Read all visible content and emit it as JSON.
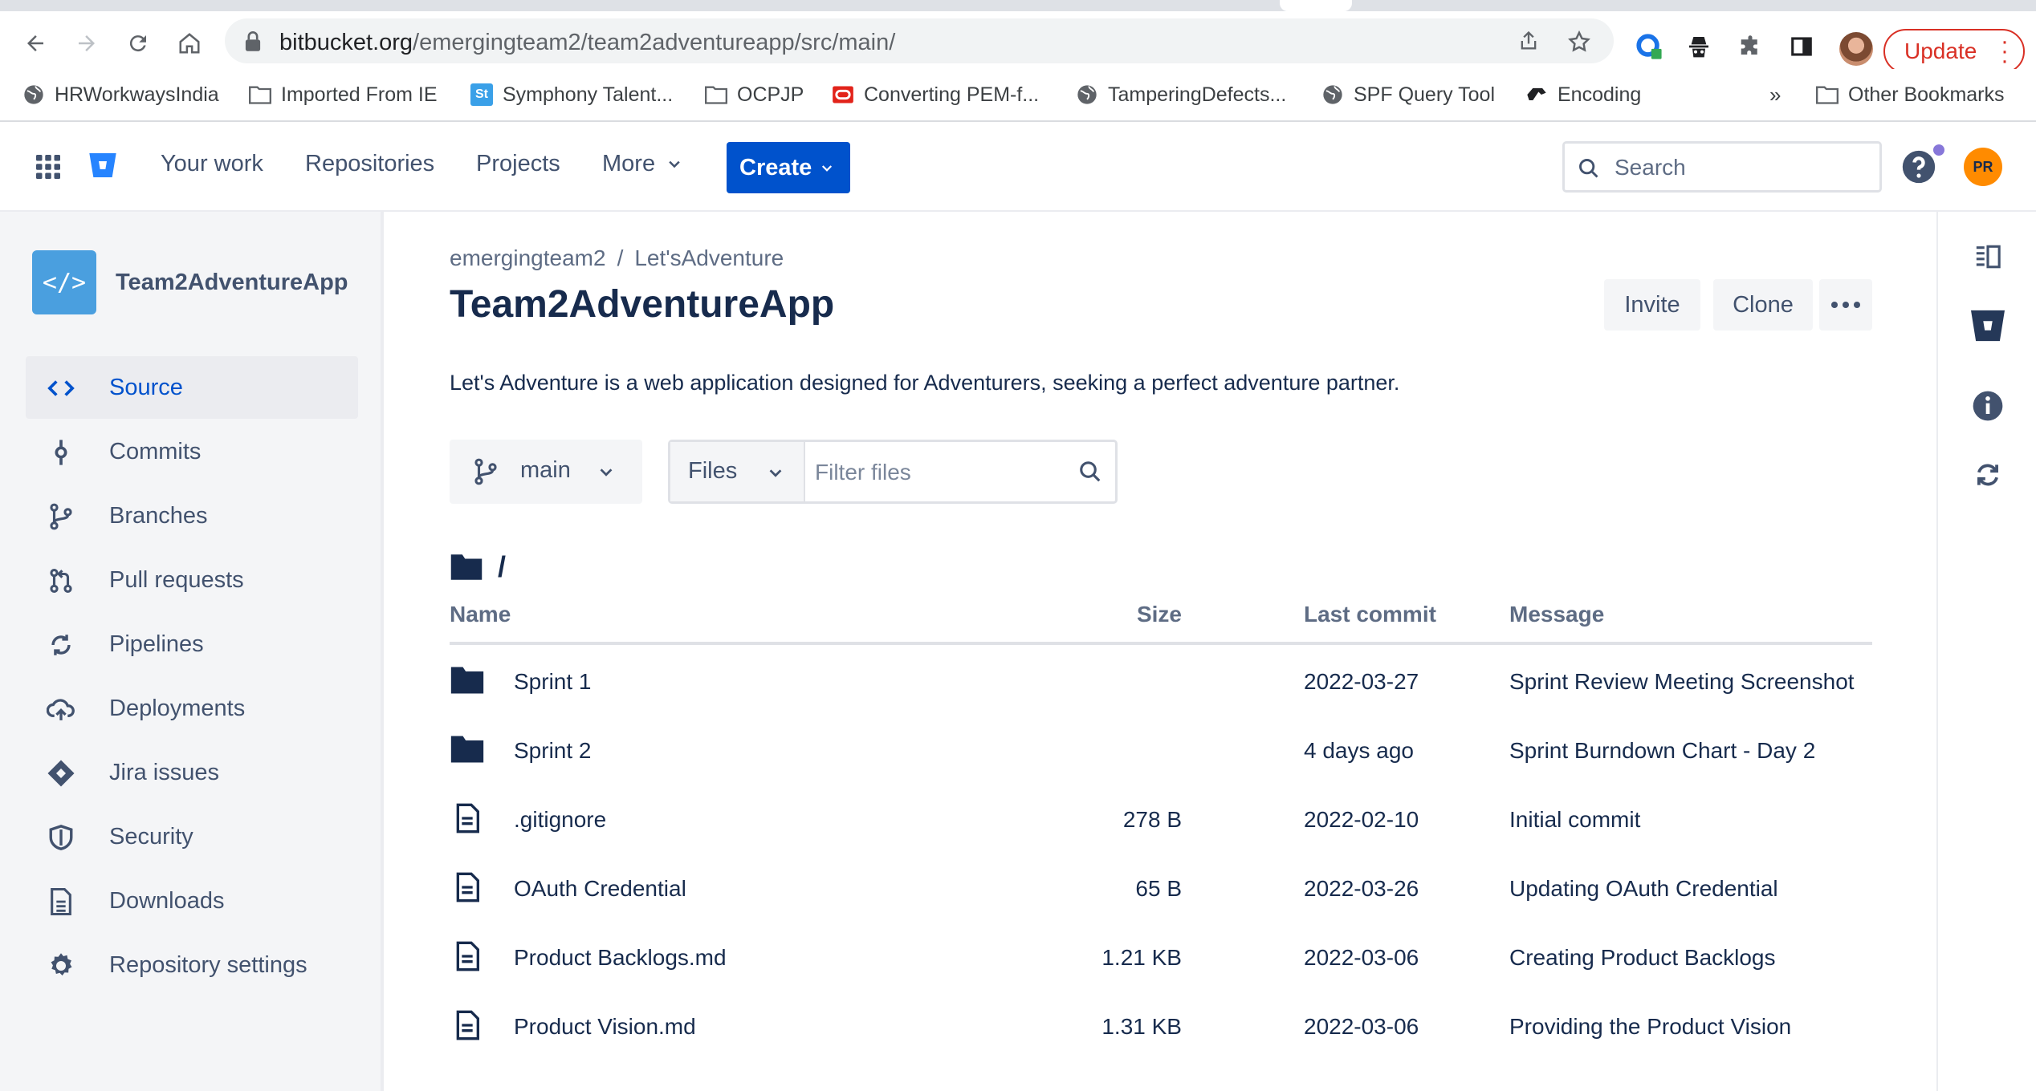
{
  "browser": {
    "url_host": "bitbucket.org",
    "url_path": "/emergingteam2/team2adventureapp/src/main/",
    "update_label": "Update",
    "bookmarks": [
      {
        "label": "HRWorkwaysIndia",
        "icon": "globe-icon"
      },
      {
        "label": "Imported From IE",
        "icon": "folder-icon"
      },
      {
        "label": "Symphony Talent...",
        "icon": "st-icon"
      },
      {
        "label": "OCPJP",
        "icon": "folder-icon"
      },
      {
        "label": "Converting PEM-f...",
        "icon": "oracle-icon"
      },
      {
        "label": "TamperingDefects...",
        "icon": "globe-icon"
      },
      {
        "label": "SPF Query Tool",
        "icon": "globe-icon"
      },
      {
        "label": "Encoding",
        "icon": "encoding-icon"
      },
      {
        "label": "Other Bookmarks",
        "icon": "folder-icon"
      }
    ],
    "overflow": "»"
  },
  "topnav": {
    "links": [
      "Your work",
      "Repositories",
      "Projects",
      "More"
    ],
    "create_label": "Create",
    "search_placeholder": "Search",
    "user_initials": "PR"
  },
  "sidebar": {
    "repo_name": "Team2AdventureApp",
    "repo_avatar_glyph": "</>",
    "items": [
      {
        "label": "Source",
        "icon": "source-icon",
        "active": true
      },
      {
        "label": "Commits",
        "icon": "commit-icon"
      },
      {
        "label": "Branches",
        "icon": "branch-icon"
      },
      {
        "label": "Pull requests",
        "icon": "pull-request-icon"
      },
      {
        "label": "Pipelines",
        "icon": "pipelines-icon"
      },
      {
        "label": "Deployments",
        "icon": "deployments-icon"
      },
      {
        "label": "Jira issues",
        "icon": "jira-icon"
      },
      {
        "label": "Security",
        "icon": "shield-icon"
      },
      {
        "label": "Downloads",
        "icon": "downloads-icon"
      },
      {
        "label": "Repository settings",
        "icon": "gear-icon"
      }
    ]
  },
  "main": {
    "breadcrumb": [
      "emergingteam2",
      "Let'sAdventure"
    ],
    "breadcrumb_sep": "/",
    "title": "Team2AdventureApp",
    "invite_label": "Invite",
    "clone_label": "Clone",
    "description": "Let's Adventure is a web application designed for Adventurers, seeking a perfect adventure partner.",
    "branch": "main",
    "files_select": "Files",
    "filter_placeholder": "Filter files",
    "path": "/",
    "columns": {
      "name": "Name",
      "size": "Size",
      "commit": "Last commit",
      "message": "Message"
    },
    "rows": [
      {
        "type": "folder",
        "name": "Sprint 1",
        "size": "",
        "commit": "2022-03-27",
        "message": "Sprint Review Meeting Screenshot"
      },
      {
        "type": "folder",
        "name": "Sprint 2",
        "size": "",
        "commit": "4 days ago",
        "message": "Sprint Burndown Chart - Day 2"
      },
      {
        "type": "file",
        "name": ".gitignore",
        "size": "278 B",
        "commit": "2022-02-10",
        "message": "Initial commit"
      },
      {
        "type": "file",
        "name": "OAuth Credential",
        "size": "65 B",
        "commit": "2022-03-26",
        "message": "Updating OAuth Credential"
      },
      {
        "type": "file",
        "name": "Product Backlogs.md",
        "size": "1.21 KB",
        "commit": "2022-03-06",
        "message": "Creating Product Backlogs"
      },
      {
        "type": "file",
        "name": "Product Vision.md",
        "size": "1.31 KB",
        "commit": "2022-03-06",
        "message": "Providing the Product Vision"
      }
    ]
  },
  "colors": {
    "accent": "#0052cc",
    "text": "#172b4d",
    "muted": "#42526e",
    "sidebar_bg": "#f4f5f7"
  }
}
